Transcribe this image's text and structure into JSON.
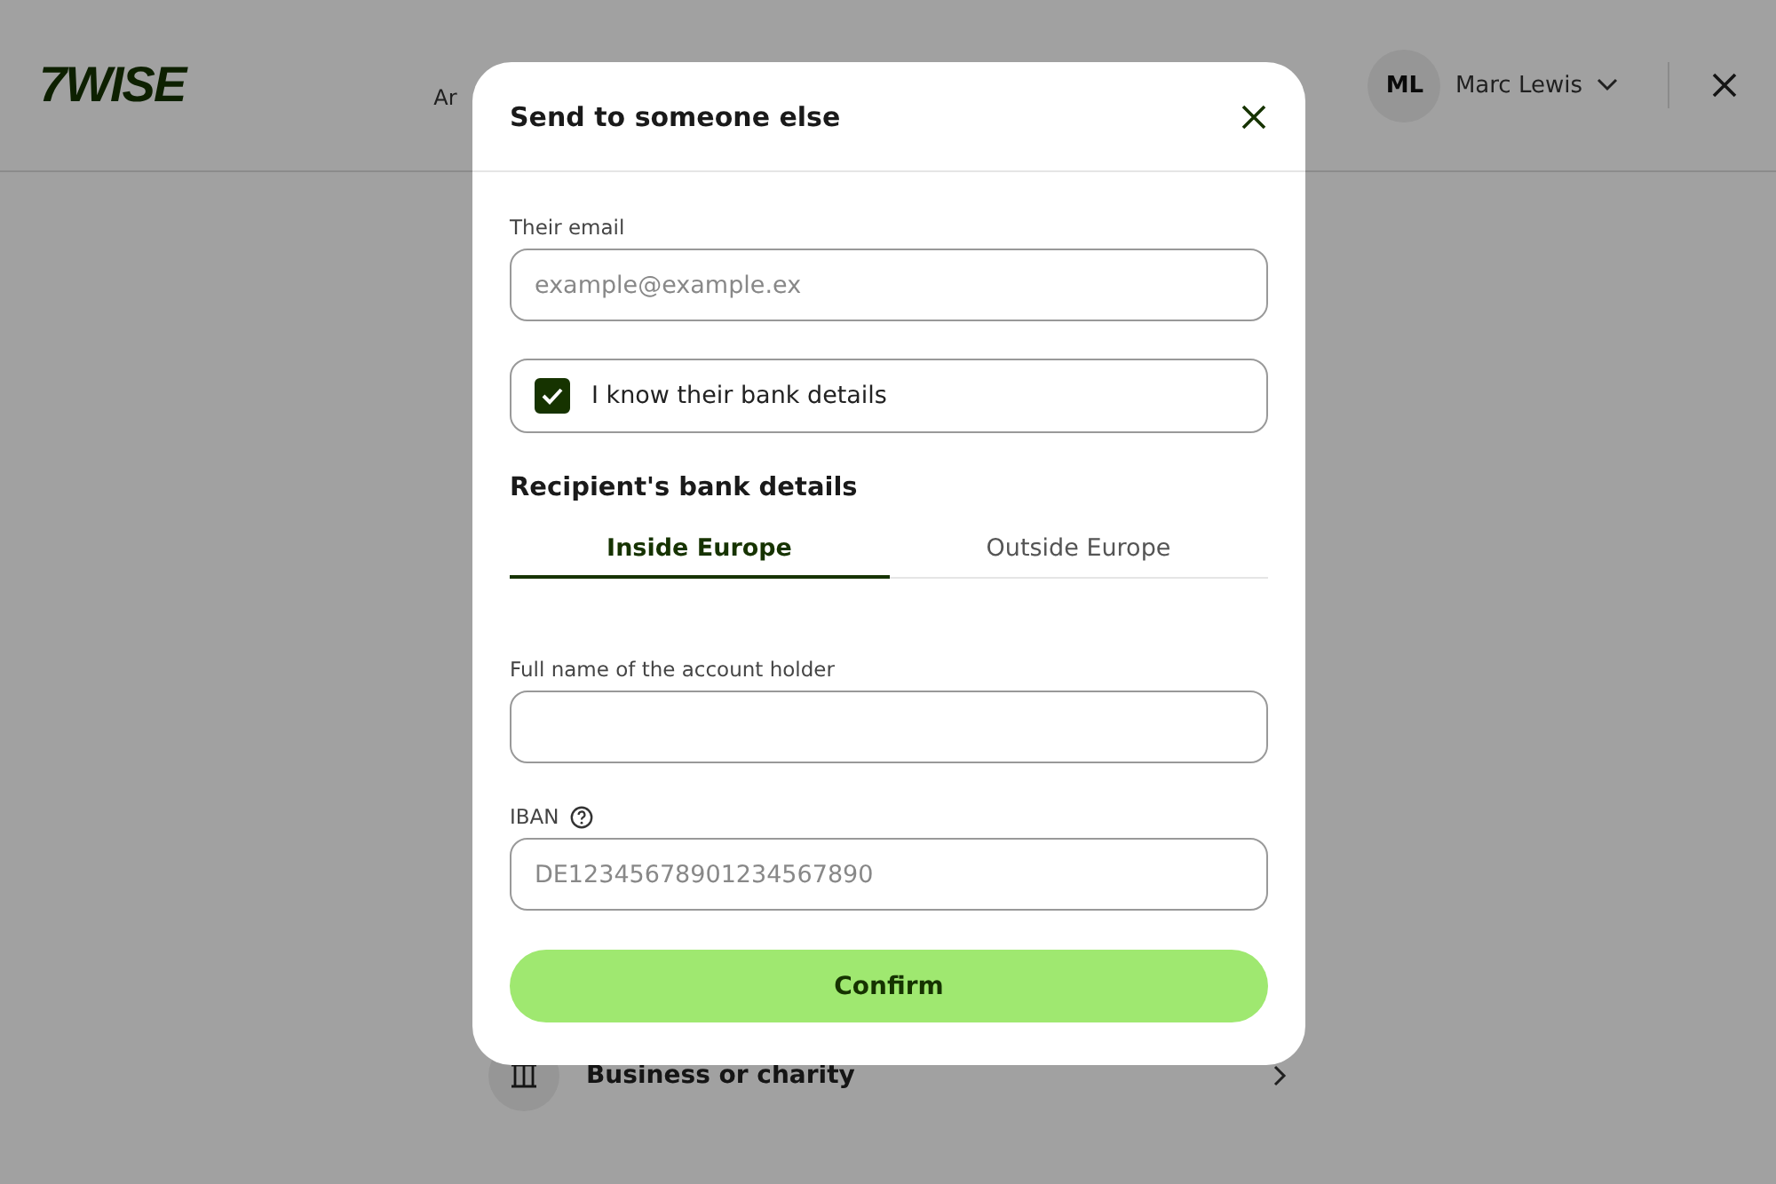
{
  "page": {
    "logo": "7WISE",
    "nav_text": "Ar",
    "user": {
      "initials": "ML",
      "name": "Marc Lewis"
    },
    "recipient_option": {
      "label": "Business or charity"
    }
  },
  "dialog": {
    "title": "Send to someone else",
    "email": {
      "label": "Their email",
      "placeholder": "example@example.ex"
    },
    "know_details": {
      "label": "I know their bank details",
      "checked": true
    },
    "section_title": "Recipient's bank details",
    "tabs": [
      {
        "label": "Inside Europe",
        "selected": true
      },
      {
        "label": "Outside Europe",
        "selected": false
      }
    ],
    "holder": {
      "label": "Full name of the account holder"
    },
    "iban": {
      "label": "IBAN",
      "placeholder": "DE12345678901234567890"
    },
    "confirm": "Confirm"
  }
}
